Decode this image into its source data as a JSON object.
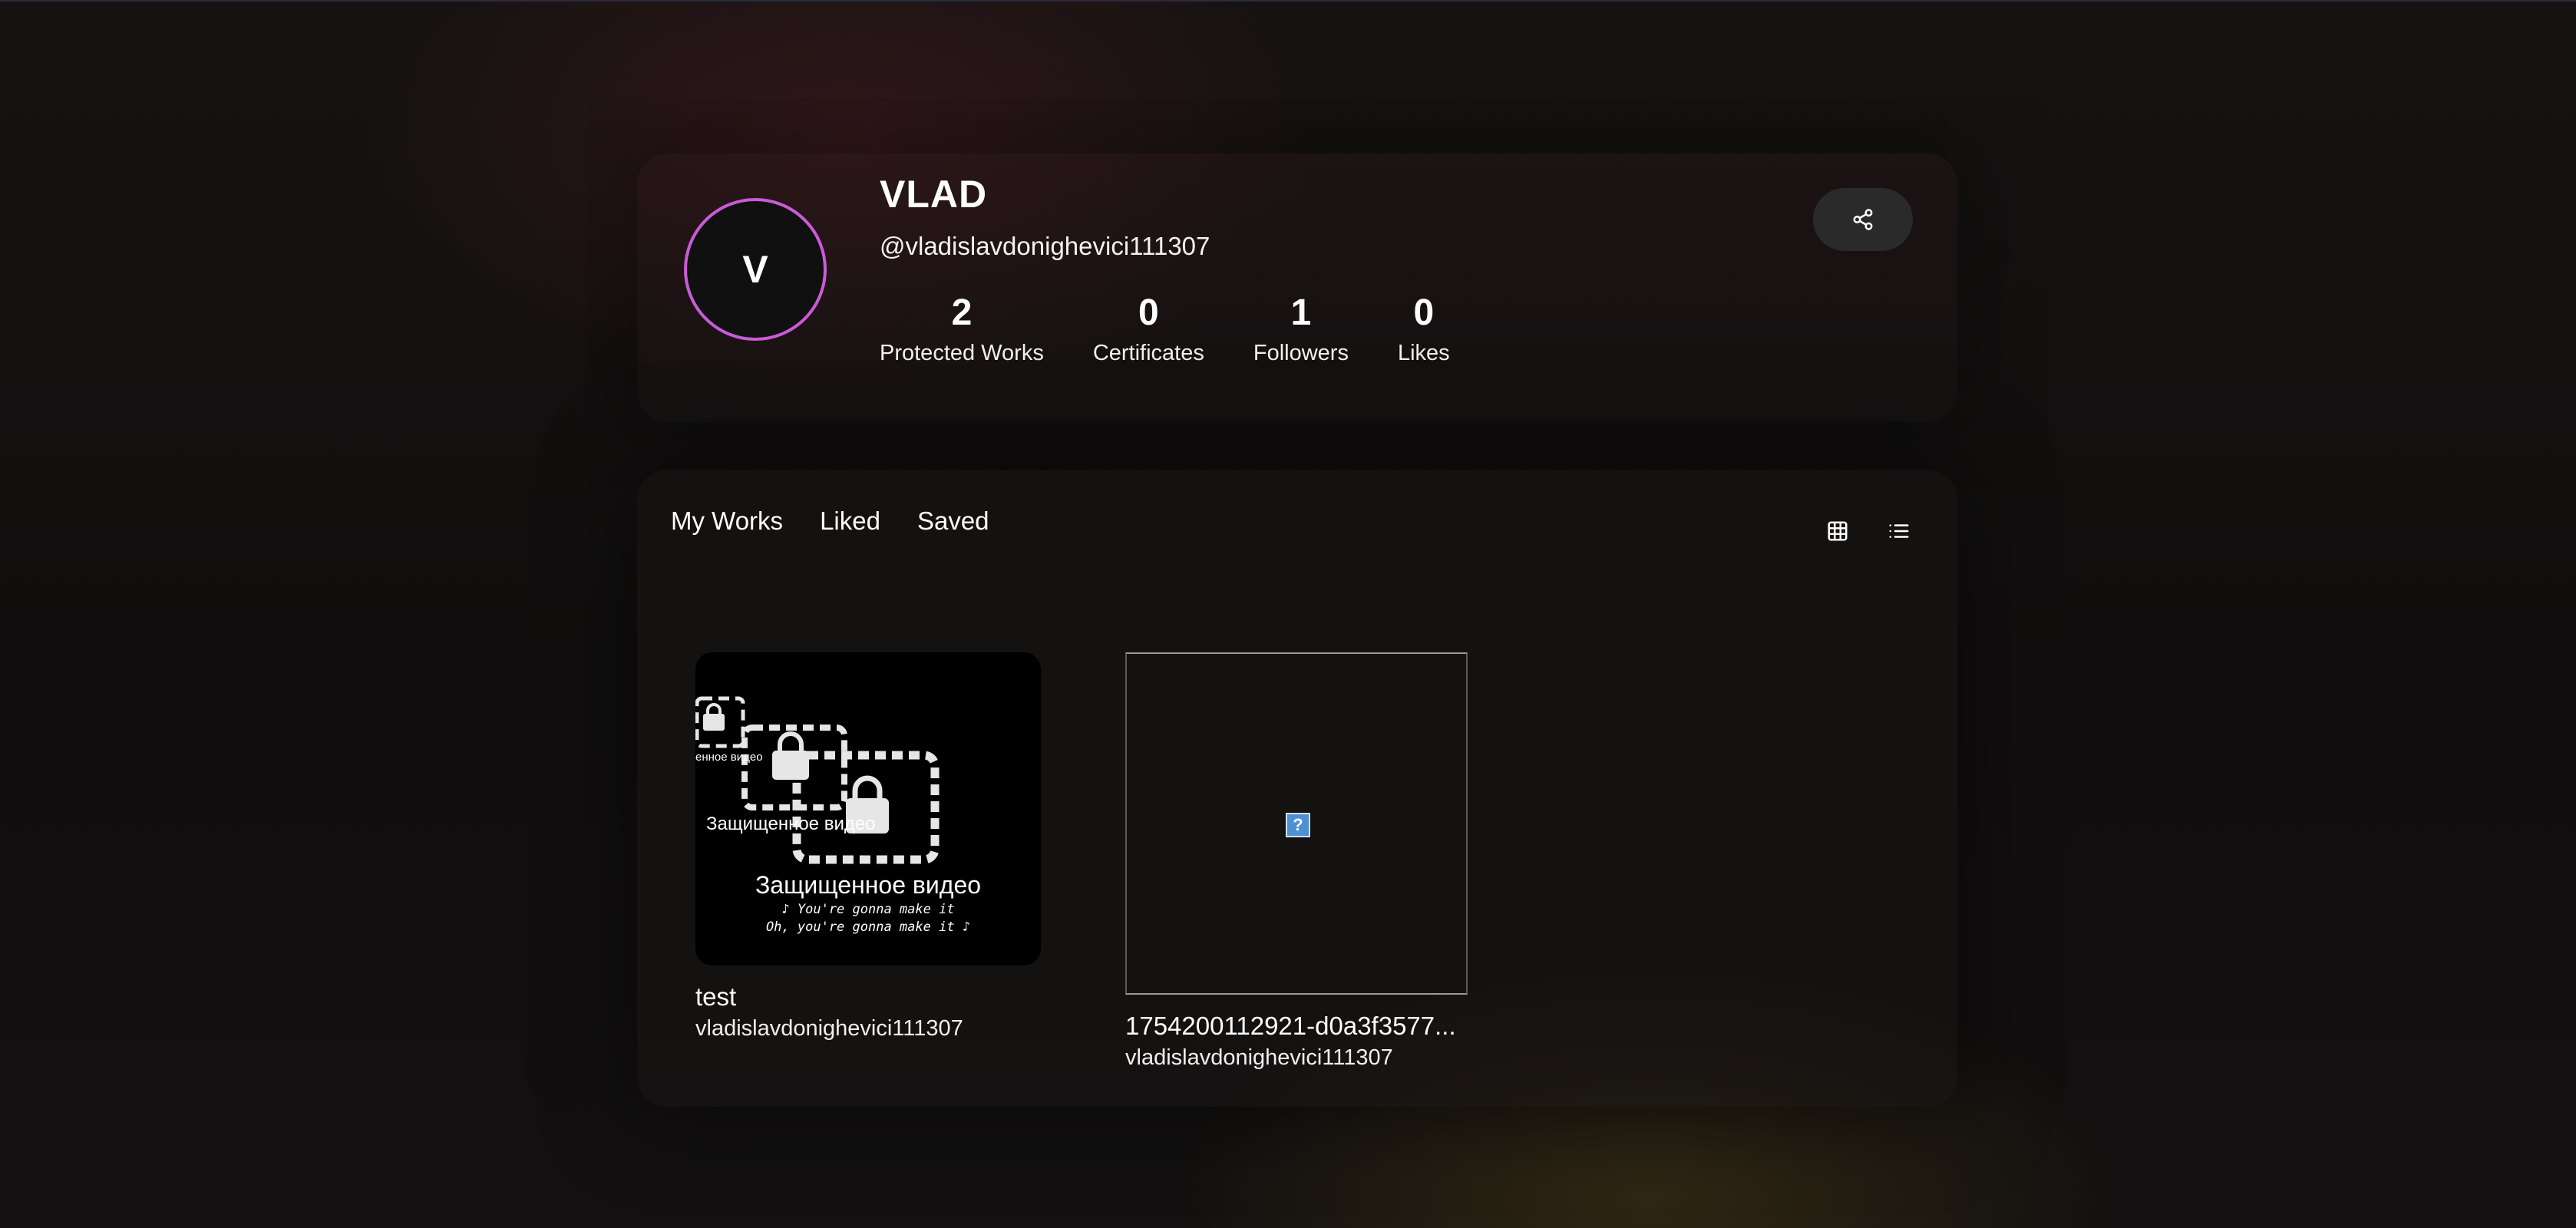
{
  "profile": {
    "avatar_initial": "V",
    "display_name": "VLAD",
    "handle": "@vladislavdonighevici111307",
    "stats": [
      {
        "value": "2",
        "label": "Protected Works"
      },
      {
        "value": "0",
        "label": "Certificates"
      },
      {
        "value": "1",
        "label": "Followers"
      },
      {
        "value": "0",
        "label": "Likes"
      }
    ],
    "share_icon": "share-icon"
  },
  "tabs": [
    {
      "label": "My Works"
    },
    {
      "label": "Liked"
    },
    {
      "label": "Saved"
    }
  ],
  "view_toggles": {
    "grid_icon": "grid-view-icon",
    "list_icon": "list-view-icon"
  },
  "works": [
    {
      "title": "test",
      "author": "vladislavdonighevici111307",
      "watermark": {
        "small_label": "енное видео",
        "mid_label": "Защищенное видео",
        "main_label": "Защищенное видео",
        "line1": "♪ You're gonna make it",
        "line2": "Oh, you're gonna make it ♪"
      }
    },
    {
      "title": "1754200112921-d0a3f3577...",
      "author": "vladislavdonighevici111307",
      "broken_image_glyph": "?"
    }
  ],
  "colors": {
    "avatar_ring": "#c95bd8",
    "background": "#0e0d0d",
    "button_bg": "#2a2a2a"
  }
}
